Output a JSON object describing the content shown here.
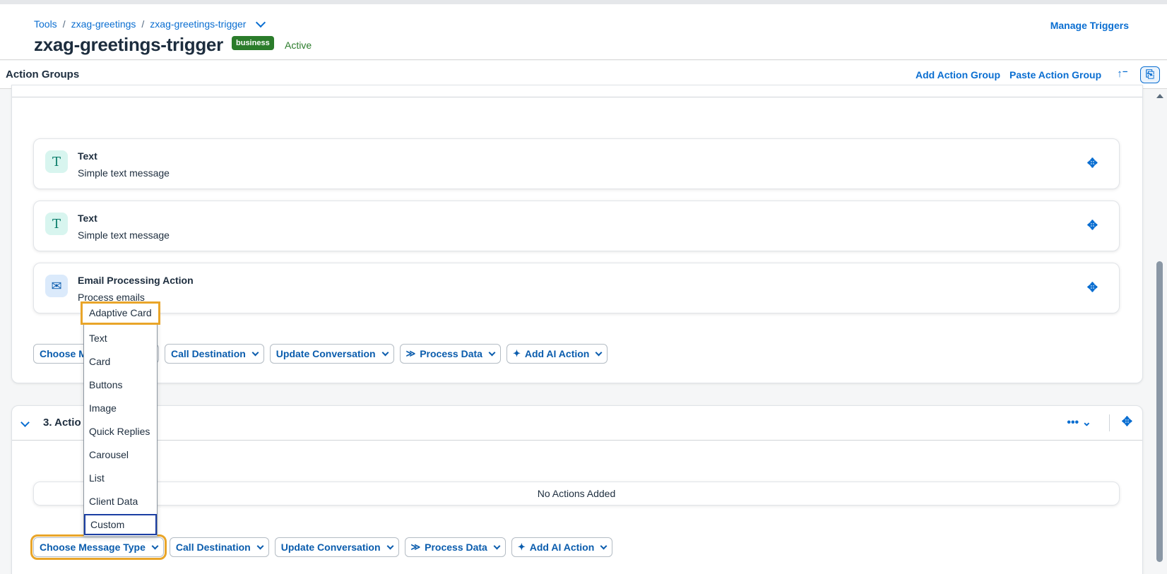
{
  "header": {
    "breadcrumb": [
      "Tools",
      "zxag-greetings",
      "zxag-greetings-trigger"
    ],
    "title": "zxag-greetings-trigger",
    "tag": "business",
    "status": "Active",
    "manage_triggers": "Manage Triggers"
  },
  "toolbar": {
    "title": "Action Groups",
    "add_group": "Add Action Group",
    "paste_group": "Paste Action Group",
    "sort_icon": "sort-ascending-icon",
    "mode_icon": "document-search-icon"
  },
  "group2": {
    "actions": [
      {
        "title": "Text",
        "subtitle": "Simple text message",
        "icon": "text-icon"
      },
      {
        "title": "Text",
        "subtitle": "Simple text message",
        "icon": "text-icon"
      },
      {
        "title": "Email Processing Action",
        "subtitle": "Process emails",
        "icon": "mail-icon"
      }
    ],
    "buttons": {
      "choose": "Choose M",
      "call": "Call Destination",
      "update": "Update Conversation",
      "process": "Process Data",
      "ai": "Add AI Action"
    }
  },
  "group3": {
    "title": "3. Actio",
    "empty_text": "No Actions Added",
    "buttons": {
      "choose": "Choose Message Type",
      "call": "Call Destination",
      "update": "Update Conversation",
      "process": "Process Data",
      "ai": "Add AI Action"
    }
  },
  "dropdown": {
    "items": [
      "Adaptive Card",
      "Text",
      "Card",
      "Buttons",
      "Image",
      "Quick Replies",
      "Carousel",
      "List",
      "Client Data",
      "Custom"
    ]
  },
  "colors": {
    "accent": "#0a6ed1",
    "focus": "#e9a529",
    "status_green": "#2b7c2b"
  }
}
